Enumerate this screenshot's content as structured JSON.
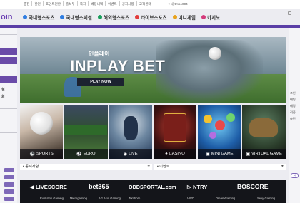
{
  "topbar": {
    "links": [
      "충전",
      "환전",
      "포인트전환",
      "출석부",
      "쪽지",
      "베팅내역",
      "이벤트",
      "공지사항",
      "고객센터"
    ],
    "contact": "@tma1004"
  },
  "logo": {
    "text": "oin"
  },
  "nav": {
    "items": [
      {
        "label": "국내형스포츠",
        "icon": "soccer-ball-icon",
        "color": "#2f7de1"
      },
      {
        "label": "국내형스페셜",
        "icon": "soccer-ball-icon",
        "color": "#2f7de1"
      },
      {
        "label": "해외형스포츠",
        "icon": "globe-icon",
        "color": "#1a9e5c"
      },
      {
        "label": "라이브스포츠",
        "icon": "live-icon",
        "color": "#e23b3b"
      },
      {
        "label": "미니게임",
        "icon": "game-icon",
        "color": "#e8a21d"
      },
      {
        "label": "카지노",
        "icon": "casino-chip-icon",
        "color": "#d43a7b"
      }
    ]
  },
  "left_panel": {
    "purple_rows": [
      "",
      "",
      "",
      ""
    ],
    "text_rows": [
      "",
      "",
      "",
      "설",
      "회"
    ],
    "badges": [
      "",
      "",
      "",
      "",
      ""
    ]
  },
  "right_panel": {
    "items": [
      "포인",
      "베팅",
      "베팅",
      "적중",
      "충전"
    ],
    "badge": "신"
  },
  "hero": {
    "subtitle": "인플레이",
    "title": "INPLAY BET",
    "button": "PLAY NOW"
  },
  "tiles": [
    {
      "label": "SPORTS",
      "icon": "soccer-ball-icon"
    },
    {
      "label": "EURO",
      "icon": "soccer-ball-icon"
    },
    {
      "label": "LIVE",
      "icon": "live-icon"
    },
    {
      "label": "CASINO",
      "icon": "casino-chip-icon"
    },
    {
      "label": "MINI GAME",
      "icon": "game-icon"
    },
    {
      "label": "VIRTUAL GAME",
      "icon": "game-icon"
    }
  ],
  "panels": [
    {
      "title": "공지사항"
    },
    {
      "title": "이벤트"
    }
  ],
  "partners": {
    "row1": [
      "LIVESCORE",
      "bet365",
      "ODDSPORTAL.com",
      "NTRY",
      "BOSCORE"
    ],
    "row2": [
      "Evolution Gaming",
      "Microgaming",
      "AG Asia Gaming",
      "Tomhorn",
      "VIVO",
      "DreamGaming",
      "Sexy Gaming"
    ]
  },
  "colors": {
    "accent": "#5a3ea6",
    "partner_bg": "#14151a"
  }
}
